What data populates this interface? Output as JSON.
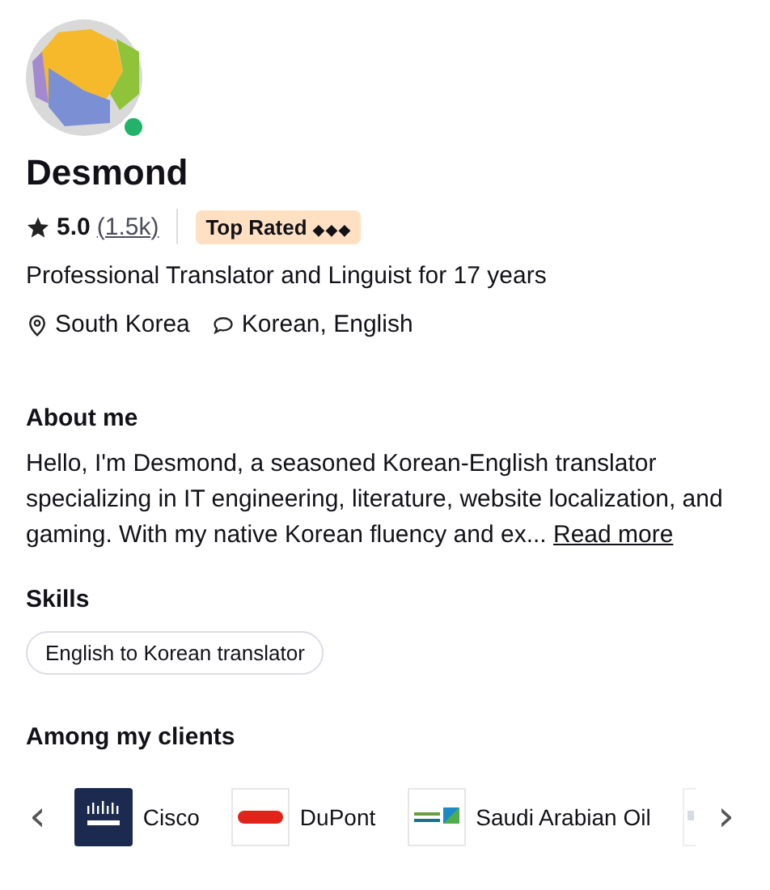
{
  "profile": {
    "name": "Desmond",
    "online": true,
    "rating": "5.0",
    "reviews": "(1.5k)",
    "badge": "Top Rated",
    "badge_marks": "◆◆◆",
    "headline": "Professional Translator and Linguist for 17 years",
    "location": "South Korea",
    "languages": "Korean, English"
  },
  "about": {
    "heading": "About me",
    "text": "Hello, I'm Desmond, a seasoned Korean-English translator specializing in IT engineering, literature, website localization, and gaming. With my native Korean fluency and ex...",
    "link": "Read more"
  },
  "skills": {
    "heading": "Skills",
    "items": [
      "English to Korean translator"
    ]
  },
  "clients": {
    "heading": "Among my clients",
    "prev": "‹",
    "next": "›",
    "items": [
      {
        "kind": "navy",
        "name": "Cisco"
      },
      {
        "kind": "red",
        "name": "DuPont"
      },
      {
        "kind": "green",
        "name": "Saudi Arabian Oil"
      },
      {
        "kind": "faded"
      }
    ]
  }
}
